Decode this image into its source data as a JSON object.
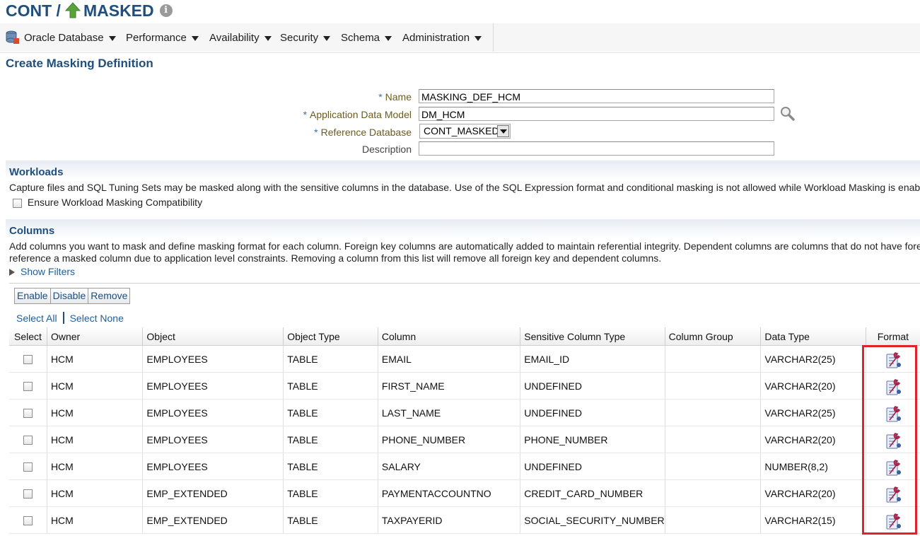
{
  "header": {
    "target_prefix": "CONT /",
    "target_name": "MASKED",
    "info_glyph": "i",
    "status_icon": "arrow-up-icon",
    "status_color": "#5aa33a"
  },
  "menubar": {
    "items": [
      {
        "label": "Oracle Database",
        "icon": "database-icon"
      },
      {
        "label": "Performance"
      },
      {
        "label": "Availability"
      },
      {
        "label": "Security"
      },
      {
        "label": "Schema"
      },
      {
        "label": "Administration"
      }
    ]
  },
  "page": {
    "title": "Create Masking Definition"
  },
  "form": {
    "required_mark": "*",
    "name_label": "Name",
    "name_value": "MASKING_DEF_HCM",
    "adm_label": "Application Data Model",
    "adm_value": "DM_HCM",
    "refdb_label": "Reference Database",
    "refdb_value": "CONT_MASKED",
    "desc_label": "Description",
    "desc_value": ""
  },
  "workloads": {
    "heading": "Workloads",
    "text": "Capture files and SQL Tuning Sets may be masked along with the sensitive columns in the database. Use of the SQL Expression format and conditional masking is not allowed while Workload Masking is enabled.",
    "checkbox_label": "Ensure Workload Masking Compatibility"
  },
  "columns": {
    "heading": "Columns",
    "text_line1": "Add columns you want to mask and define masking format for each column. Foreign key columns are automatically added to maintain referential integrity. Dependent columns are columns that do not have foreig",
    "text_line2": "reference a masked column due to application level constraints. Removing a column from this list will remove all foreign key and dependent columns.",
    "show_filters": "Show Filters",
    "toolbar": {
      "enable": "Enable",
      "disable": "Disable",
      "remove": "Remove"
    },
    "select_all": "Select All",
    "select_none": "Select None"
  },
  "table": {
    "headers": {
      "select": "Select",
      "owner": "Owner",
      "object": "Object",
      "object_type": "Object Type",
      "column": "Column",
      "sensitive_type": "Sensitive Column Type",
      "column_group": "Column Group",
      "data_type": "Data Type",
      "format": "Format"
    },
    "rows": [
      {
        "owner": "HCM",
        "object": "EMPLOYEES",
        "object_type": "TABLE",
        "column": "EMAIL",
        "sensitive_type": "EMAIL_ID",
        "column_group": "",
        "data_type": "VARCHAR2(25)"
      },
      {
        "owner": "HCM",
        "object": "EMPLOYEES",
        "object_type": "TABLE",
        "column": "FIRST_NAME",
        "sensitive_type": "UNDEFINED",
        "column_group": "",
        "data_type": "VARCHAR2(20)"
      },
      {
        "owner": "HCM",
        "object": "EMPLOYEES",
        "object_type": "TABLE",
        "column": "LAST_NAME",
        "sensitive_type": "UNDEFINED",
        "column_group": "",
        "data_type": "VARCHAR2(25)"
      },
      {
        "owner": "HCM",
        "object": "EMPLOYEES",
        "object_type": "TABLE",
        "column": "PHONE_NUMBER",
        "sensitive_type": "PHONE_NUMBER",
        "column_group": "",
        "data_type": "VARCHAR2(20)"
      },
      {
        "owner": "HCM",
        "object": "EMPLOYEES",
        "object_type": "TABLE",
        "column": "SALARY",
        "sensitive_type": "UNDEFINED",
        "column_group": "",
        "data_type": "NUMBER(8,2)"
      },
      {
        "owner": "HCM",
        "object": "EMP_EXTENDED",
        "object_type": "TABLE",
        "column": "PAYMENTACCOUNTNO",
        "sensitive_type": "CREDIT_CARD_NUMBER",
        "column_group": "",
        "data_type": "VARCHAR2(20)"
      },
      {
        "owner": "HCM",
        "object": "EMP_EXTENDED",
        "object_type": "TABLE",
        "column": "TAXPAYERID",
        "sensitive_type": "SOCIAL_SECURITY_NUMBER",
        "column_group": "",
        "data_type": "VARCHAR2(15)"
      }
    ],
    "format_icon": "masking-format-wrench-icon",
    "highlight_color": "#e0222b"
  }
}
